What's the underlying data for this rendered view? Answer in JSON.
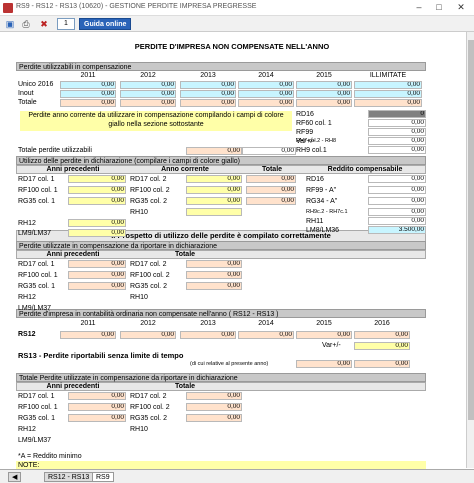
{
  "window": {
    "title": "RS9 - RS12 - RS13 (10620) - GESTIONE PERDITE IMPRESA PREGRESSE"
  },
  "toolbar": {
    "number": "1",
    "guida": "Guida online"
  },
  "main_title": "PERDITE D'IMPRESA NON COMPENSATE NELL'ANNO",
  "sec1": {
    "header": "Perdite utilizzabili in compensazione",
    "years": [
      "2011",
      "2012",
      "2013",
      "2014",
      "2015",
      "ILLIMITATE"
    ],
    "rows": [
      {
        "label": "Unico 2016",
        "values": [
          "0,00",
          "0,00",
          "0,00",
          "0,00",
          "0,00",
          "0,00"
        ]
      },
      {
        "label": "Inout",
        "values": [
          "0,00",
          "0,00",
          "0,00",
          "0,00",
          "0,00",
          "0,00"
        ]
      },
      {
        "label": "Totale",
        "values": [
          "0,00",
          "0,00",
          "0,00",
          "0,00",
          "0,00",
          "0,00"
        ]
      }
    ],
    "note": "Perdite anno corrente da utilizzare in compensazione compilando i campi di colore giallo nella sezione sottostante",
    "right_labels": [
      "RD16",
      "RF60 col. 1",
      "RF99",
      "RH7 col.2 - RH8",
      "RH9 col.1"
    ],
    "right_values": [
      "0",
      "0,00",
      "0,00",
      "0,00",
      "0,00"
    ],
    "varpm_label": "Var+/-",
    "varpm_value": "0,00",
    "totale_label": "Totale perdite utilizzabili",
    "totale_values": [
      "0,00",
      "0,00"
    ]
  },
  "sec2": {
    "header": "Utilizzo delle perdite in dichiarazione (compilare i campi di colore giallo)",
    "col_titles": [
      "Anni precedenti",
      "Anno corrente",
      "Totale",
      "Reddito compensabile"
    ],
    "left_labels": [
      "RD17 col. 1",
      "RF100 col. 1",
      "RG35 col. 1",
      "",
      "RH12",
      "LM9/LM37"
    ],
    "left_values": [
      "0,00",
      "0,00",
      "0,00",
      "",
      "0,00",
      "0,00"
    ],
    "mid_labels": [
      "RD17 col. 2",
      "RF100 col. 2",
      "RG35 col. 2",
      "RH10"
    ],
    "mid_values": [
      "0,00",
      "0,00",
      "0,00",
      ""
    ],
    "tot_values": [
      "0,00",
      "0,00",
      "0,00"
    ],
    "red_labels": [
      "RD16",
      "RF99 - A\"",
      "RG34 - A\"",
      "RH9c.2 - RH7c.1",
      "RH11",
      "LM8/LM36"
    ],
    "red_values": [
      "0,00",
      "0,00",
      "0,00",
      "0,00",
      "0,00",
      "3.500,00"
    ]
  },
  "banner": "Il Prospetto di utilizzo delle perdite è compilato correttamente",
  "sec3": {
    "header": "Perdite utilizzate in compensazione da riportare in dichiarazione",
    "col_titles": [
      "Anni precedenti",
      "Totale"
    ],
    "left_labels": [
      "RD17 col. 1",
      "RF100 col. 1",
      "RG35 col. 1",
      "RH12",
      "LM9/LM37"
    ],
    "left_values": [
      "0,00",
      "0,00",
      "0,00",
      "",
      ""
    ],
    "right_labels": [
      "RD17 col. 2",
      "RF100 col. 2",
      "RG35 col. 2",
      "RH10"
    ],
    "right_values": [
      "0,00",
      "0,00",
      "0,00",
      ""
    ]
  },
  "sec4": {
    "header": "Perdite d'impresa in contabilità ordinaria non compensate nell'anno ( RS12 - RS13 )",
    "years": [
      "2011",
      "2012",
      "2013",
      "2014",
      "2015",
      "2016"
    ],
    "rs12_label": "RS12",
    "rs12_values": [
      "0,00",
      "0,00",
      "0,00",
      "0,00",
      "0,00",
      "0,00"
    ],
    "varpm_label": "Var+/-",
    "varpm_value": "0,00",
    "rs13_label": "RS13 - Perdite riportabili senza limite di tempo",
    "rs13_sub": "(di cui relative al presente anno)",
    "rs13_values": [
      "0,00",
      "0,00"
    ]
  },
  "sec5": {
    "header": "Totale Perdite utilizzate in compensazione da riportare in dichiarazione",
    "col_titles": [
      "Anni precedenti",
      "Totale"
    ],
    "left_labels": [
      "RD17 col. 1",
      "RF100 col. 1",
      "RG35 col. 1",
      "RH12",
      "LM9/LM37"
    ],
    "left_values": [
      "0,00",
      "0,00",
      "0,00",
      "",
      ""
    ],
    "right_labels": [
      "RD17 col. 2",
      "RF100 col. 2",
      "RG35 col. 2",
      "RH10"
    ],
    "right_values": [
      "0,00",
      "0,00",
      "0,00",
      ""
    ]
  },
  "footnote": "*A = Reddito minimo",
  "note_label": "NOTE:",
  "tabs": [
    "RS12 - RS13",
    "RS9"
  ]
}
